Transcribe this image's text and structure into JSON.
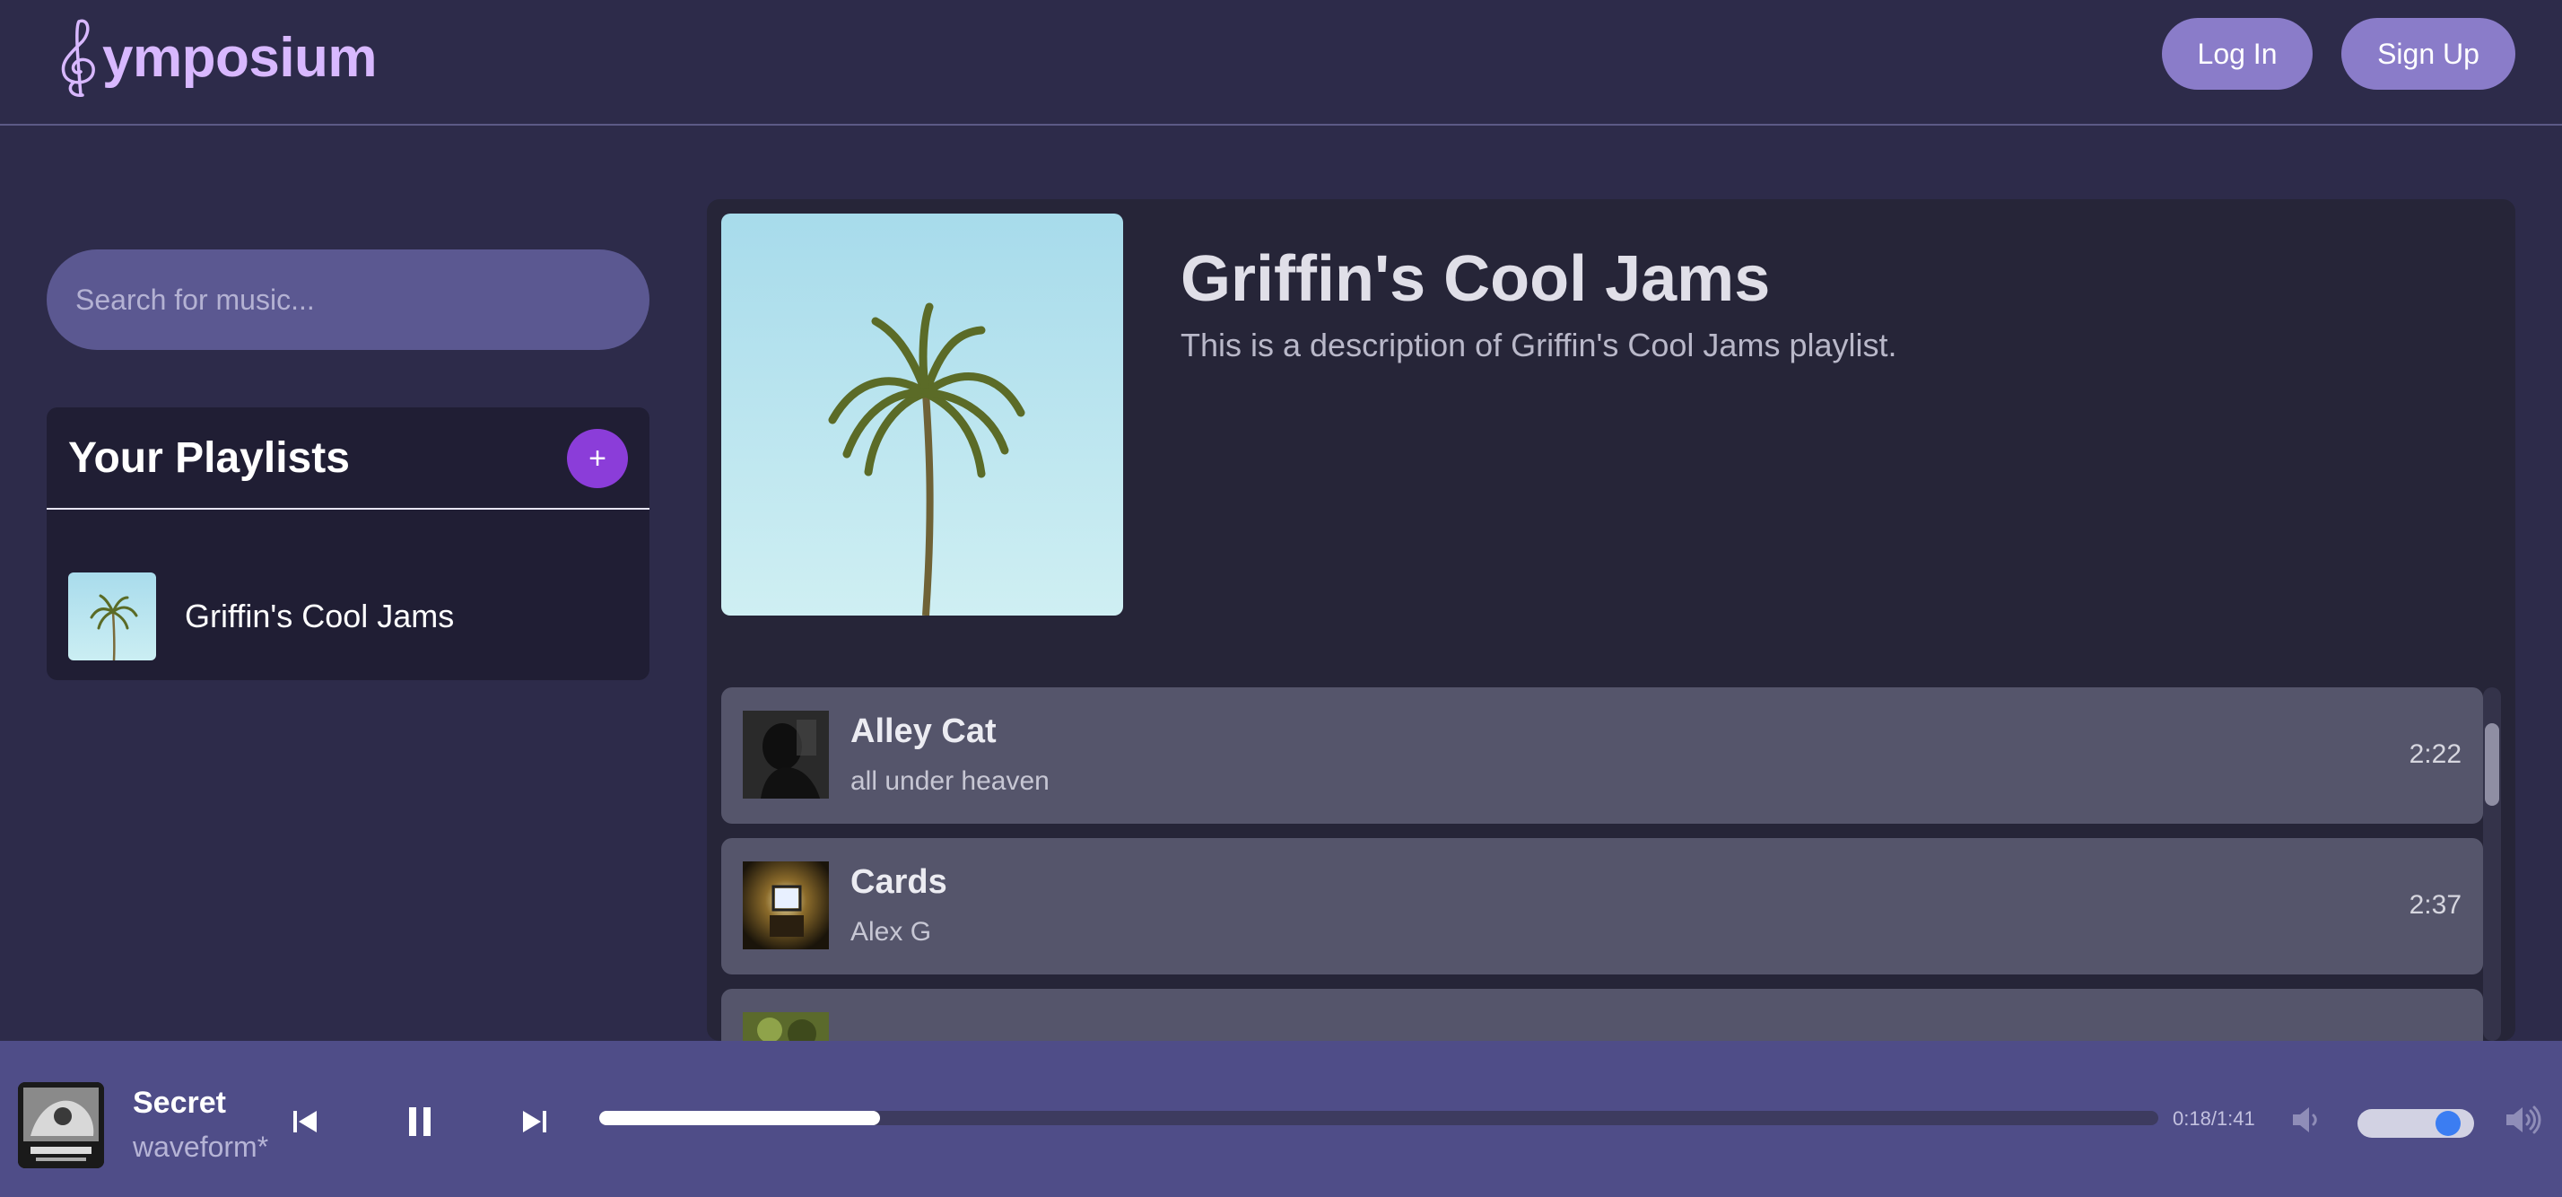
{
  "header": {
    "logo_text": "ymposium",
    "login_label": "Log In",
    "signup_label": "Sign Up"
  },
  "sidebar": {
    "search_placeholder": "Search for music...",
    "playlists_title": "Your Playlists",
    "add_label": "+",
    "playlists": [
      {
        "label": "Griffin's Cool Jams"
      }
    ]
  },
  "playlist": {
    "title": "Griffin's Cool Jams",
    "description": "This is a description of Griffin's Cool Jams playlist.",
    "tracks": [
      {
        "title": "Alley Cat",
        "artist": "all under heaven",
        "duration": "2:22"
      },
      {
        "title": "Cards",
        "artist": "Alex G",
        "duration": "2:37"
      },
      {
        "title": "",
        "artist": "",
        "duration": ""
      }
    ]
  },
  "player": {
    "title": "Secret",
    "artist": "waveform*",
    "time": "0:18/1:41",
    "progress_fraction": 0.18,
    "volume_fraction": 0.85
  },
  "colors": {
    "background": "#2d2b4a",
    "accent": "#8a7cc9",
    "add_button": "#8b3dd9",
    "player_bar": "#4f4d88"
  },
  "icons": {
    "logo": "treble-clef-icon",
    "prev": "skip-previous-icon",
    "pause": "pause-icon",
    "next": "skip-next-icon",
    "vol_low": "volume-low-icon",
    "vol_high": "volume-high-icon"
  }
}
